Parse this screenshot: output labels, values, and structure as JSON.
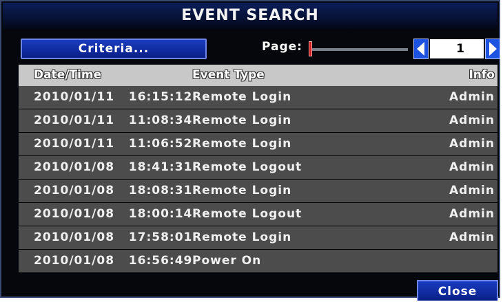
{
  "window": {
    "title": "EVENT SEARCH"
  },
  "toolbar": {
    "criteria_label": "Criteria...",
    "page_label": "Page:",
    "page_value": "1",
    "nav_left_icon": "arrow-left-icon",
    "nav_right_icon": "arrow-right-icon",
    "slider_value": 0
  },
  "table": {
    "headers": {
      "datetime": "Date/Time",
      "event_type": "Event Type",
      "info": "Info"
    },
    "rows": [
      {
        "datetime": "2010/01/11   16:15:12",
        "event_type": "Remote Login",
        "info": "Admin"
      },
      {
        "datetime": "2010/01/11   11:08:34",
        "event_type": "Remote Login",
        "info": "Admin"
      },
      {
        "datetime": "2010/01/11   11:06:52",
        "event_type": "Remote Login",
        "info": "Admin"
      },
      {
        "datetime": "2010/01/08   18:41:31",
        "event_type": "Remote Logout",
        "info": "Admin"
      },
      {
        "datetime": "2010/01/08   18:08:31",
        "event_type": "Remote Login",
        "info": "Admin"
      },
      {
        "datetime": "2010/01/08   18:00:14",
        "event_type": "Remote Logout",
        "info": "Admin"
      },
      {
        "datetime": "2010/01/08   17:58:01",
        "event_type": "Remote Login",
        "info": "Admin"
      },
      {
        "datetime": "2010/01/08   16:56:49",
        "event_type": "Power On",
        "info": ""
      }
    ]
  },
  "footer": {
    "close_label": "Close"
  },
  "colors": {
    "title_bar": "#071237",
    "button_blue": "#1a3cc0",
    "header_gray": "#c8c8c8",
    "row_gray": "#4c4c4c",
    "slider_handle": "#d21a1a"
  }
}
